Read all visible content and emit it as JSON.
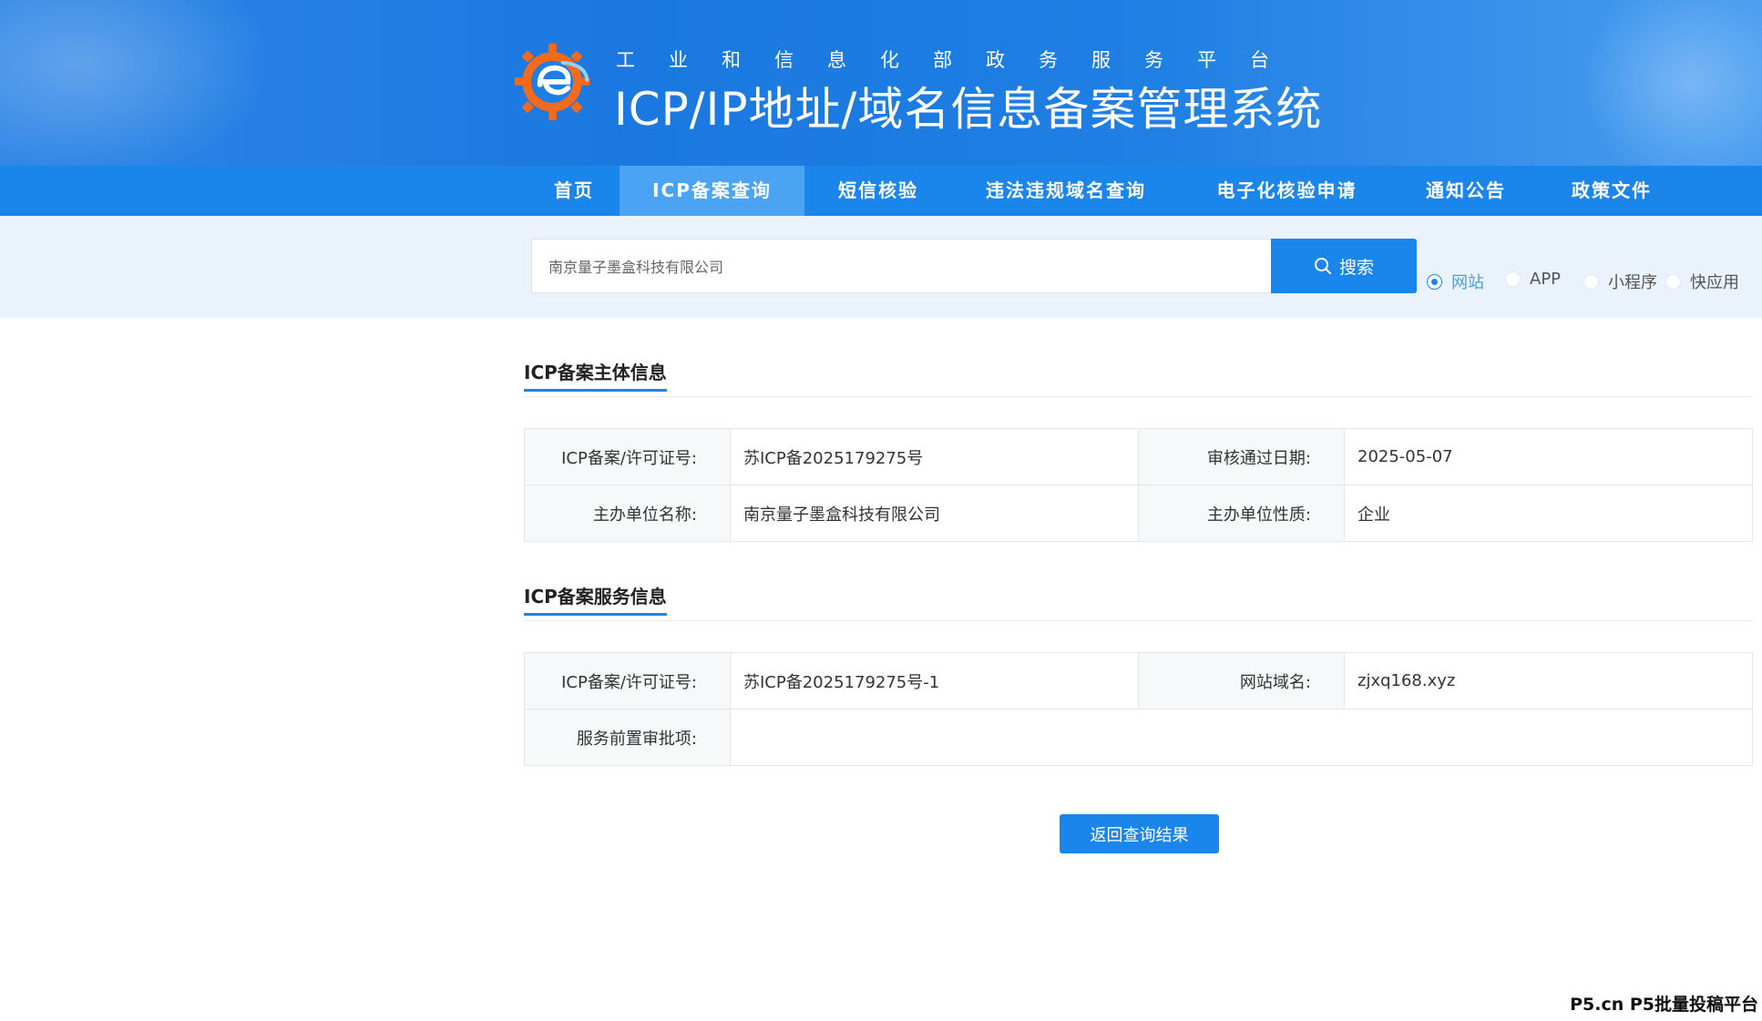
{
  "header": {
    "subtitle": "工业和信息化部政务服务平台",
    "title": "ICP/IP地址/域名信息备案管理系统",
    "logo_icon": "gear-e-logo"
  },
  "nav": {
    "items": [
      {
        "label": "首页"
      },
      {
        "label": "ICP备案查询",
        "active": true
      },
      {
        "label": "短信核验"
      },
      {
        "label": "违法违规域名查询"
      },
      {
        "label": "电子化核验申请"
      },
      {
        "label": "通知公告"
      },
      {
        "label": "政策文件"
      }
    ]
  },
  "search": {
    "value": "南京量子墨盒科技有限公司",
    "button_label": "搜索",
    "button_icon": "search-icon",
    "types": [
      {
        "label": "网站",
        "checked": true
      },
      {
        "label": "APP",
        "checked": false
      },
      {
        "label": "小程序",
        "checked": false
      },
      {
        "label": "快应用",
        "checked": false
      }
    ]
  },
  "subject_info": {
    "title": "ICP备案主体信息",
    "rows": [
      {
        "label1": "ICP备案/许可证号:",
        "value1": "苏ICP备2025179275号",
        "label2": "审核通过日期:",
        "value2": "2025-05-07"
      },
      {
        "label1": "主办单位名称:",
        "value1": "南京量子墨盒科技有限公司",
        "label2": "主办单位性质:",
        "value2": "企业"
      }
    ]
  },
  "service_info": {
    "title": "ICP备案服务信息",
    "rows": [
      {
        "label1": "ICP备案/许可证号:",
        "value1": "苏ICP备2025179275号-1",
        "label2": "网站域名:",
        "value2": "zjxq168.xyz"
      },
      {
        "label1": "服务前置审批项:",
        "value1": ""
      }
    ]
  },
  "return_button": "返回查询结果",
  "watermark": "P5.cn P5批量投稿平台",
  "colors": {
    "primary": "#1a86ec",
    "nav_active": "#4aa3f3",
    "search_band": "#eaf3fb"
  }
}
